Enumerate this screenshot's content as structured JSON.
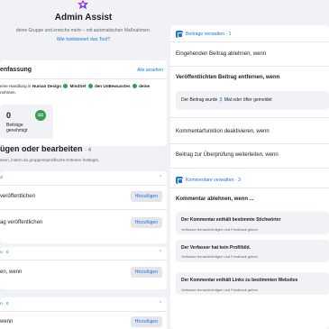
{
  "header": {
    "title": "Admin Assist",
    "subtitle": "deine Gruppe und erreiche mehr – mit automatischen Maßnahmen.",
    "link": "Wie funktioniert das Tool?"
  },
  "summary": {
    "title": "enfassung",
    "link": "Alle ansehen",
    "text_prefix": "eine Handlung in",
    "criteria": [
      "Human Design",
      "MindSet",
      "den UnBewusstes",
      "deine"
    ],
    "text_suffix": "nohmen.",
    "stat_value": "0",
    "stat_label_line1": "Beiträge",
    "stat_label_line2": "genehmigt"
  },
  "section": {
    "title": "ügen oder bearbeiten",
    "count": "· 4",
    "subtitle": "ssen, indem du gruppenspezifische Kriterien festlegst."
  },
  "rule_groups": [
    {
      "head": "d",
      "rows": [
        {
          "label": "veröffentlichen",
          "button": "Hinzufügen"
        },
        {
          "label": "ag veröffentlichen",
          "button": "Hinzufügen"
        }
      ]
    },
    {
      "head": "n · 0",
      "rows": [
        {
          "label": "en, wenn",
          "button": "Hinzufügen"
        }
      ]
    },
    {
      "head": "n · 0",
      "rows": [
        {
          "label": "wenn",
          "button": "Hinzufügen"
        }
      ]
    }
  ],
  "panel": {
    "posts_head": "Beiträge verwalten · 1",
    "items": [
      "Eingehenden Beitrag ablehnen, wenn",
      "Veröffentlichten Beitrag entfernen, wenn",
      "Kommentarfunktion deaktivieren, wenn",
      "Beitrag zur Überprüfung weiterleiten, wenn"
    ],
    "condition_prefix": "Der Beitrag wurde",
    "condition_number": "2",
    "condition_suffix": "Mal oder öfter gemeldet",
    "comments_head": "Kommentare verwalten · 3",
    "comments_title": "Kommentar ablehnen, wenn ...",
    "comment_conditions": [
      {
        "title": "Der Kommentar enthält bestimmte Stichwörter",
        "sub": "Verfasser benachrichtigen und Feedback geben"
      },
      {
        "title": "Der Verfasser hat kein Profilbild.",
        "sub": "Verfasser benachrichtigen und Feedback geben"
      },
      {
        "title": "Der Kommentar enthält Links zu bestimmten Websites",
        "sub": "Verfasser benachrichtigen und Feedback geben"
      }
    ]
  },
  "colors": {
    "accent": "#1b74e4",
    "success": "#31a24c",
    "background": "#f0f2f5"
  }
}
